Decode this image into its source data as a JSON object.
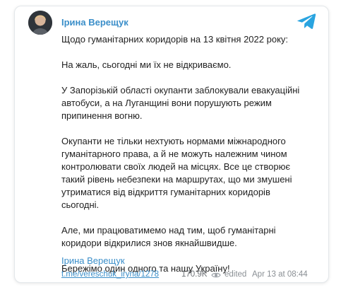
{
  "post": {
    "author": "Ірина Верещук",
    "paragraphs": [
      "Щодо гуманітарних коридорів на 13 квітня 2022 року:",
      "На жаль, сьогодні ми їх не відкриваємо.",
      "У Запорізькій області окупанти заблокували евакуаційні автобуси, а на Луганщині вони порушують режим припинення вогню.",
      "Окупанти не тільки нехтують нормами міжнародного гуманітарного права, а й не можуть належним чином контролювати своїх людей на місцях. Все це створює такий рівень небезпеки на маршрутах, що ми змушені утриматися від відкриття гуманітарних коридорів сьогодні.",
      "Але, ми працюватимемо над тим, щоб гуманітарні коридори відкрилися знов якнайшвидше.",
      "Бережімо один одного та нашу Україну!"
    ],
    "signature": "Ірина Верещук",
    "link_text": "t.me/vereschuk_iryna/1278",
    "views": "170.9K",
    "edited_label": "edited",
    "date": "Apr 13 at 08:44"
  },
  "icons": {
    "telegram": "telegram-logo-icon",
    "eye": "eye-icon",
    "avatar": "avatar"
  },
  "colors": {
    "accent": "#3a8ec9",
    "telegram": "#2aa4e0",
    "muted": "#8a8f94",
    "text": "#1f1f1f"
  }
}
